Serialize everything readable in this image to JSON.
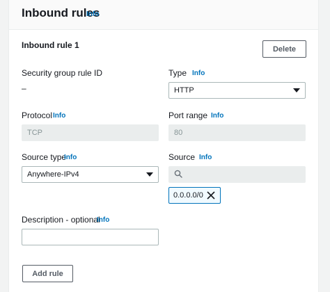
{
  "section": {
    "title": "Inbound rules",
    "info": "Info"
  },
  "rule": {
    "title": "Inbound rule 1",
    "delete_label": "Delete",
    "sg_rule_id": {
      "label": "Security group rule ID",
      "value": "–"
    },
    "type": {
      "label": "Type",
      "info": "Info",
      "value": "HTTP"
    },
    "protocol": {
      "label": "Protocol",
      "info": "Info",
      "value": "TCP"
    },
    "port_range": {
      "label": "Port range",
      "info": "Info",
      "value": "80"
    },
    "source_type": {
      "label": "Source type",
      "info": "Info",
      "value": "Anywhere-IPv4"
    },
    "source": {
      "label": "Source",
      "info": "Info",
      "search_placeholder": "",
      "token": "0.0.0.0/0"
    },
    "description": {
      "label": "Description - optional",
      "info": "Info",
      "value": ""
    }
  },
  "actions": {
    "add_rule_label": "Add rule"
  },
  "icons": {
    "search": "search-icon",
    "remove_token": "close-icon",
    "dropdown": "caret-down-icon"
  },
  "colors": {
    "link": "#0073bb",
    "disabled_bg": "#eaeded",
    "token_bg": "#f1faff",
    "border": "#aab7b8"
  }
}
